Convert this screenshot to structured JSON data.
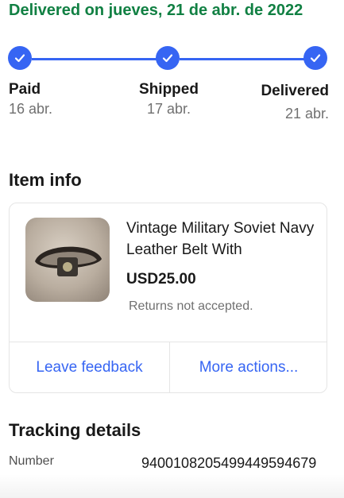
{
  "status": {
    "headline": "Delivered on jueves, 21 de abr. de 2022",
    "color": "#118043"
  },
  "progress": {
    "accent_color": "#3665f3",
    "steps": [
      {
        "label": "Paid",
        "date": "16 abr.",
        "icon": "check-icon"
      },
      {
        "label": "Shipped",
        "date": "17 abr.",
        "icon": "check-icon"
      },
      {
        "label": "Delivered",
        "date": "21 abr.",
        "icon": "check-icon"
      }
    ]
  },
  "item_info": {
    "section_title": "Item info",
    "title": "Vintage Military Soviet Navy Leather Belt With",
    "price": "USD25.00",
    "returns": "Returns not accepted.",
    "actions": {
      "leave_feedback": "Leave feedback",
      "more_actions": "More actions..."
    }
  },
  "tracking": {
    "section_title": "Tracking details",
    "number_label": "Number",
    "number_value": "9400108205499449594679"
  }
}
